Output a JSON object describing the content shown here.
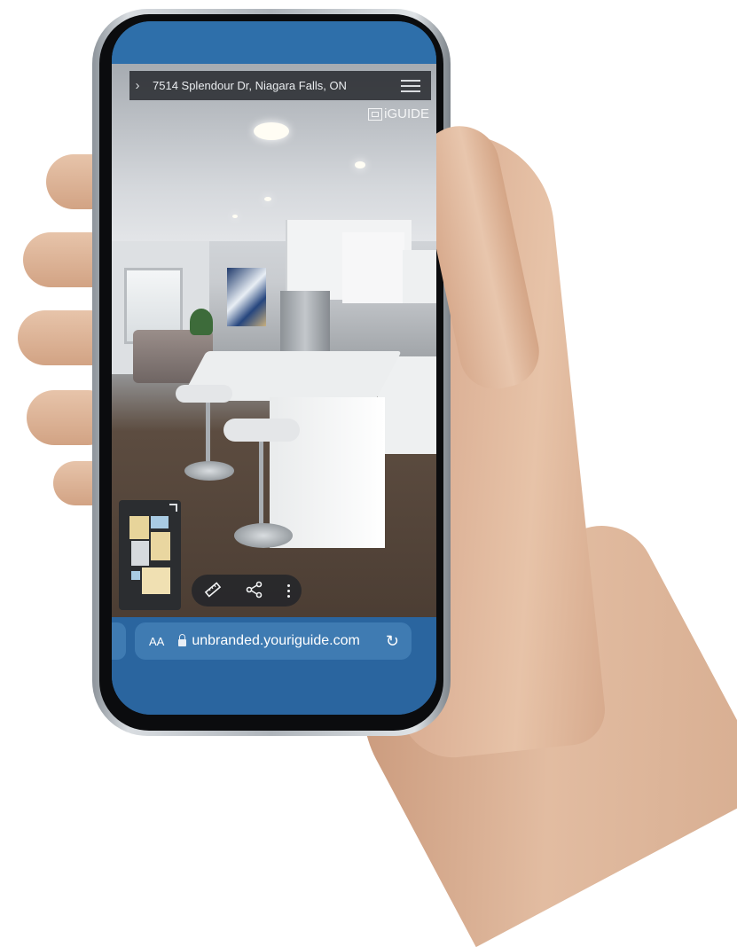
{
  "tour": {
    "address": "7514 Splendour Dr, Niagara Falls, ON",
    "brand": "iGUIDE"
  },
  "browser": {
    "text_size_label": "AA",
    "url": "unbranded.youriguide.com"
  },
  "icons": {
    "expand": "chevron-right-icon",
    "menu": "hamburger-menu-icon",
    "measure": "ruler-icon",
    "share": "share-icon",
    "more": "more-vertical-icon",
    "lock": "lock-icon",
    "reload": "reload-icon"
  },
  "colors": {
    "browser_chrome": "#2a659f",
    "url_field": "#3f7bb2",
    "overlay_bar": "#28292e"
  }
}
